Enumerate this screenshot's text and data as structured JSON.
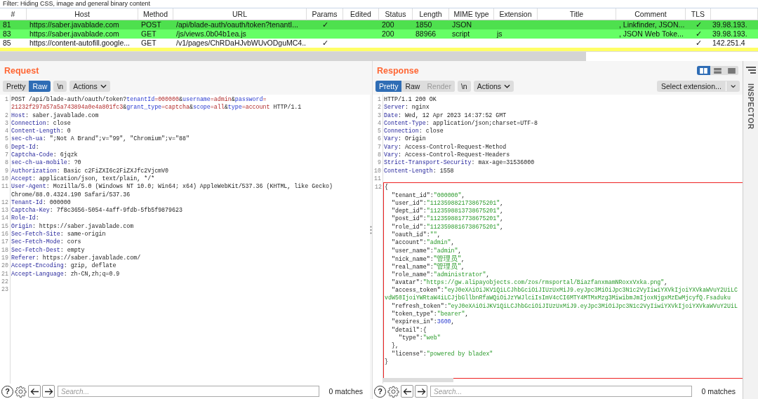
{
  "filter": {
    "text": "Filter: Hiding CSS, image and general binary content"
  },
  "history_table": {
    "columns": [
      "#",
      "Host",
      "Method",
      "URL",
      "Params",
      "Edited",
      "Status",
      "Length",
      "MIME type",
      "Extension",
      "Title",
      "Comment",
      "TLS",
      null
    ],
    "rows": [
      {
        "color": "#4ee04e",
        "cells": [
          "81",
          "https://saber.javablade.com",
          "POST",
          "/api/blade-auth/oauth/token?tenantI...",
          "✓",
          null,
          "200",
          "1850",
          "JSON",
          null,
          null,
          ", Linkfinder, JSON...",
          "✓",
          "39.98.193."
        ]
      },
      {
        "color": "#66ff66",
        "cells": [
          "83",
          "https://saber.javablade.com",
          "GET",
          "/js/views.0b04b1ea.js",
          null,
          null,
          "200",
          "88966",
          "script",
          "js",
          null,
          ", JSON Web Toke...",
          "✓",
          "39.98.193."
        ]
      },
      {
        "color": "#ffffff",
        "cells": [
          "85",
          "https://content-autofill.google...",
          "GET",
          "/v1/pages/ChRDaHJvbWUvODguMC4...",
          "✓",
          null,
          null,
          null,
          null,
          null,
          null,
          null,
          "✓",
          "142.251.4"
        ]
      },
      {
        "color": "#ffff66"
      }
    ]
  },
  "request": {
    "title": "Request",
    "view_tabs": [
      {
        "label": "Pretty",
        "selected": false,
        "disabled": false
      },
      {
        "label": "Raw",
        "selected": true,
        "disabled": false
      }
    ],
    "newline_button": "\\n",
    "actions_button": "Actions",
    "lines": [
      {
        "number": "1",
        "segs": [
          {
            "kind": "plain",
            "text": "POST /api/blade-auth/oauth/token?"
          },
          {
            "kind": "param",
            "text": "tenantId"
          },
          {
            "kind": "value",
            "text": "=000000"
          },
          {
            "kind": "plain",
            "text": "&"
          },
          {
            "kind": "param",
            "text": "username"
          },
          {
            "kind": "value",
            "text": "=admin"
          },
          {
            "kind": "plain",
            "text": "&"
          },
          {
            "kind": "param",
            "text": "password"
          },
          {
            "kind": "value",
            "text": "="
          }
        ]
      },
      {
        "segs": [
          {
            "kind": "value",
            "text": "21232f297a57a5a743894a0e4a801fc3"
          },
          {
            "kind": "plain",
            "text": "&"
          },
          {
            "kind": "param",
            "text": "grant_type"
          },
          {
            "kind": "value",
            "text": "=captcha"
          },
          {
            "kind": "plain",
            "text": "&"
          },
          {
            "kind": "param",
            "text": "scope"
          },
          {
            "kind": "value",
            "text": "=all"
          },
          {
            "kind": "plain",
            "text": "&"
          },
          {
            "kind": "param",
            "text": "type"
          },
          {
            "kind": "value",
            "text": "=account"
          },
          {
            "kind": "plain",
            "text": " HTTP/1.1"
          }
        ]
      },
      {
        "number": "2",
        "segs": [
          {
            "kind": "key",
            "text": "Host"
          },
          {
            "kind": "plain",
            "text": ": saber.javablade.com"
          }
        ]
      },
      {
        "number": "3",
        "segs": [
          {
            "kind": "key",
            "text": "Connection"
          },
          {
            "kind": "plain",
            "text": ": close"
          }
        ]
      },
      {
        "number": "4",
        "segs": [
          {
            "kind": "key",
            "text": "Content-Length"
          },
          {
            "kind": "plain",
            "text": ": 0"
          }
        ]
      },
      {
        "number": "5",
        "segs": [
          {
            "kind": "key",
            "text": "sec-ch-ua"
          },
          {
            "kind": "plain",
            "text": ": \";Not A Brand\";v=\"99\", \"Chromium\";v=\"88\""
          }
        ]
      },
      {
        "number": "6",
        "segs": [
          {
            "kind": "key",
            "text": "Dept-Id"
          },
          {
            "kind": "plain",
            "text": ":"
          }
        ]
      },
      {
        "number": "7",
        "segs": [
          {
            "kind": "key",
            "text": "Captcha-Code"
          },
          {
            "kind": "plain",
            "text": ": 6jqzk"
          }
        ]
      },
      {
        "number": "8",
        "segs": [
          {
            "kind": "key",
            "text": "sec-ch-ua-mobile"
          },
          {
            "kind": "plain",
            "text": ": ?0"
          }
        ]
      },
      {
        "number": "9",
        "segs": [
          {
            "kind": "key",
            "text": "Authorization"
          },
          {
            "kind": "plain",
            "text": ": Basic c2FiZXI6c2FiZXJfc2VjcmV0"
          }
        ]
      },
      {
        "number": "10",
        "segs": [
          {
            "kind": "key",
            "text": "Accept"
          },
          {
            "kind": "plain",
            "text": ": application/json, text/plain, */*"
          }
        ]
      },
      {
        "number": "11",
        "segs": [
          {
            "kind": "key",
            "text": "User-Agent"
          },
          {
            "kind": "plain",
            "text": ": Mozilla/5.0 (Windows NT 10.0; Win64; x64) AppleWebKit/537.36 (KHTML, like Gecko)"
          }
        ]
      },
      {
        "segs": [
          {
            "kind": "plain",
            "text": "Chrome/88.0.4324.190 Safari/537.36"
          }
        ]
      },
      {
        "number": "12",
        "segs": [
          {
            "kind": "key",
            "text": "Tenant-Id"
          },
          {
            "kind": "plain",
            "text": ": 000000"
          }
        ]
      },
      {
        "number": "13",
        "segs": [
          {
            "kind": "key",
            "text": "Captcha-Key"
          },
          {
            "kind": "plain",
            "text": ": 7f8c3656-5054-4aff-9fdb-5fb5f9879623"
          }
        ]
      },
      {
        "number": "14",
        "segs": [
          {
            "kind": "key",
            "text": "Role-Id"
          },
          {
            "kind": "plain",
            "text": ":"
          }
        ]
      },
      {
        "number": "15",
        "segs": [
          {
            "kind": "key",
            "text": "Origin"
          },
          {
            "kind": "plain",
            "text": ": https://saber.javablade.com"
          }
        ]
      },
      {
        "number": "16",
        "segs": [
          {
            "kind": "key",
            "text": "Sec-Fetch-Site"
          },
          {
            "kind": "plain",
            "text": ": same-origin"
          }
        ]
      },
      {
        "number": "17",
        "segs": [
          {
            "kind": "key",
            "text": "Sec-Fetch-Mode"
          },
          {
            "kind": "plain",
            "text": ": cors"
          }
        ]
      },
      {
        "number": "18",
        "segs": [
          {
            "kind": "key",
            "text": "Sec-Fetch-Dest"
          },
          {
            "kind": "plain",
            "text": ": empty"
          }
        ]
      },
      {
        "number": "19",
        "segs": [
          {
            "kind": "key",
            "text": "Referer"
          },
          {
            "kind": "plain",
            "text": ": https://saber.javablade.com/"
          }
        ]
      },
      {
        "number": "20",
        "segs": [
          {
            "kind": "key",
            "text": "Accept-Encoding"
          },
          {
            "kind": "plain",
            "text": ": gzip, deflate"
          }
        ]
      },
      {
        "number": "21",
        "segs": [
          {
            "kind": "key",
            "text": "Accept-Language"
          },
          {
            "kind": "plain",
            "text": ": zh-CN,zh;q=0.9"
          }
        ]
      },
      {
        "number": "22"
      },
      {
        "number": "23"
      }
    ],
    "help_button": "?",
    "search": {
      "placeholder": "Search..."
    },
    "matches": "0 matches"
  },
  "response": {
    "title": "Response",
    "layout_buttons": [
      {
        "kind": "columns",
        "selected": true
      },
      {
        "kind": "rows",
        "selected": false
      },
      {
        "kind": "single",
        "selected": false
      }
    ],
    "view_tabs": [
      {
        "label": "Pretty",
        "selected": true,
        "disabled": false
      },
      {
        "label": "Raw",
        "selected": false,
        "disabled": false
      },
      {
        "label": "Render",
        "selected": false,
        "disabled": true
      }
    ],
    "newline_button": "\\n",
    "actions_button": "Actions",
    "extension_select": "Select extension...",
    "lines": [
      {
        "number": "1",
        "segs": [
          {
            "kind": "plain",
            "text": "HTTP/1.1 200 OK"
          }
        ]
      },
      {
        "number": "2",
        "segs": [
          {
            "kind": "key",
            "text": "Server"
          },
          {
            "kind": "plain",
            "text": ": nginx"
          }
        ]
      },
      {
        "number": "3",
        "segs": [
          {
            "kind": "key",
            "text": "Date"
          },
          {
            "kind": "plain",
            "text": ": Wed, 12 Apr 2023 14:37:52 GMT"
          }
        ]
      },
      {
        "number": "4",
        "segs": [
          {
            "kind": "key",
            "text": "Content-Type"
          },
          {
            "kind": "plain",
            "text": ": application/json;charset=UTF-8"
          }
        ]
      },
      {
        "number": "5",
        "segs": [
          {
            "kind": "key",
            "text": "Connection"
          },
          {
            "kind": "plain",
            "text": ": close"
          }
        ]
      },
      {
        "number": "6",
        "segs": [
          {
            "kind": "key",
            "text": "Vary"
          },
          {
            "kind": "plain",
            "text": ": Origin"
          }
        ]
      },
      {
        "number": "7",
        "segs": [
          {
            "kind": "key",
            "text": "Vary"
          },
          {
            "kind": "plain",
            "text": ": Access-Control-Request-Method"
          }
        ]
      },
      {
        "number": "8",
        "segs": [
          {
            "kind": "key",
            "text": "Vary"
          },
          {
            "kind": "plain",
            "text": ": Access-Control-Request-Headers"
          }
        ]
      },
      {
        "number": "9",
        "segs": [
          {
            "kind": "key",
            "text": "Strict-Transport-Security"
          },
          {
            "kind": "plain",
            "text": ": max-age=31536000"
          }
        ]
      },
      {
        "number": "10",
        "segs": [
          {
            "kind": "key",
            "text": "Content-Length"
          },
          {
            "kind": "plain",
            "text": ": 1558"
          }
        ]
      },
      {
        "number": "11"
      }
    ],
    "body_highlighted": true,
    "body_lines": [
      {
        "number": "12",
        "segs": [
          {
            "kind": "plain",
            "text": "{"
          }
        ]
      },
      {
        "segs": [
          {
            "kind": "plain",
            "text": "  \"tenant_id\":"
          },
          {
            "kind": "string",
            "text": "\"000000\""
          },
          {
            "kind": "plain",
            "text": ","
          }
        ]
      },
      {
        "segs": [
          {
            "kind": "plain",
            "text": "  \"user_id\":"
          },
          {
            "kind": "string",
            "text": "\"1123598821738675201\""
          },
          {
            "kind": "plain",
            "text": ","
          }
        ]
      },
      {
        "segs": [
          {
            "kind": "plain",
            "text": "  \"dept_id\":"
          },
          {
            "kind": "string",
            "text": "\"1123598813738675201\""
          },
          {
            "kind": "plain",
            "text": ","
          }
        ]
      },
      {
        "segs": [
          {
            "kind": "plain",
            "text": "  \"post_id\":"
          },
          {
            "kind": "string",
            "text": "\"1123598817738675201\""
          },
          {
            "kind": "plain",
            "text": ","
          }
        ]
      },
      {
        "segs": [
          {
            "kind": "plain",
            "text": "  \"role_id\":"
          },
          {
            "kind": "string",
            "text": "\"1123598816738675201\""
          },
          {
            "kind": "plain",
            "text": ","
          }
        ]
      },
      {
        "segs": [
          {
            "kind": "plain",
            "text": "  \"oauth_id\":"
          },
          {
            "kind": "string",
            "text": "\"\""
          },
          {
            "kind": "plain",
            "text": ","
          }
        ]
      },
      {
        "segs": [
          {
            "kind": "plain",
            "text": "  \"account\":"
          },
          {
            "kind": "string",
            "text": "\"admin\""
          },
          {
            "kind": "plain",
            "text": ","
          }
        ]
      },
      {
        "segs": [
          {
            "kind": "plain",
            "text": "  \"user_name\":"
          },
          {
            "kind": "string",
            "text": "\"admin\""
          },
          {
            "kind": "plain",
            "text": ","
          }
        ]
      },
      {
        "segs": [
          {
            "kind": "plain",
            "text": "  \"nick_name\":"
          },
          {
            "kind": "cjk_string",
            "text": "\"管理员\""
          },
          {
            "kind": "plain",
            "text": ","
          }
        ]
      },
      {
        "segs": [
          {
            "kind": "plain",
            "text": "  \"real_name\":"
          },
          {
            "kind": "cjk_string",
            "text": "\"管理员\""
          },
          {
            "kind": "plain",
            "text": ","
          }
        ]
      },
      {
        "segs": [
          {
            "kind": "plain",
            "text": "  \"role_name\":"
          },
          {
            "kind": "string",
            "text": "\"administrator\""
          },
          {
            "kind": "plain",
            "text": ","
          }
        ]
      },
      {
        "segs": [
          {
            "kind": "plain",
            "text": "  \"avatar\":"
          },
          {
            "kind": "string",
            "text": "\"https://gw.alipayobjects.com/zos/rmsportal/BiazfanxmamNRoxxVxka.png\""
          },
          {
            "kind": "plain",
            "text": ","
          }
        ]
      },
      {
        "segs": [
          {
            "kind": "plain",
            "text": "  \"access_token\":"
          },
          {
            "kind": "string",
            "text": "\"eyJ0eXAiOiJKV1QiLCJhbGciOiJIUzUxMiJ9.eyJpc3MiOiJpc3N1c2VyIiwiYXVkIjoiYXVkaWVuY2UiLC"
          }
        ]
      },
      {
        "segs": [
          {
            "kind": "string",
            "text": "vdW50IjoiYWRtaW4iLCJjbGllbnRfaWQiOiJzYWJlciIsImV4cCI6MTY4MTMxMzg3MiwibmJmIjoxNjgxMzEwMjcyfQ.Fsaduku"
          }
        ]
      },
      {
        "segs": [
          {
            "kind": "plain",
            "text": "  \"refresh_token\":"
          },
          {
            "kind": "string",
            "text": "\"eyJ0eXAiOiJKV1QiLCJhbGciOiJIUzUxMiJ9.eyJpc3MiOiJpc3N1c2VyIiwiYXVkIjoiYXVkaWVuY2UiL"
          }
        ]
      },
      {
        "segs": [
          {
            "kind": "plain",
            "text": "  \"token_type\":"
          },
          {
            "kind": "string",
            "text": "\"bearer\""
          },
          {
            "kind": "plain",
            "text": ","
          }
        ]
      },
      {
        "segs": [
          {
            "kind": "plain",
            "text": "  \"expires_in\":"
          },
          {
            "kind": "number",
            "text": "3600"
          },
          {
            "kind": "plain",
            "text": ","
          }
        ]
      },
      {
        "segs": [
          {
            "kind": "plain",
            "text": "  \"detail\":{"
          }
        ]
      },
      {
        "segs": [
          {
            "kind": "plain",
            "text": "    \"type\":"
          },
          {
            "kind": "string",
            "text": "\"web\""
          }
        ]
      },
      {
        "segs": [
          {
            "kind": "plain",
            "text": "  },"
          }
        ]
      },
      {
        "segs": [
          {
            "kind": "plain",
            "text": "  \"license\":"
          },
          {
            "kind": "string",
            "text": "\"powered by bladex\""
          }
        ]
      },
      {
        "segs": [
          {
            "kind": "plain",
            "text": "}"
          }
        ]
      }
    ],
    "help_button": "?",
    "search": {
      "placeholder": "Search..."
    },
    "matches": "0 matches"
  },
  "inspector": {
    "label": "INSPECTOR"
  }
}
